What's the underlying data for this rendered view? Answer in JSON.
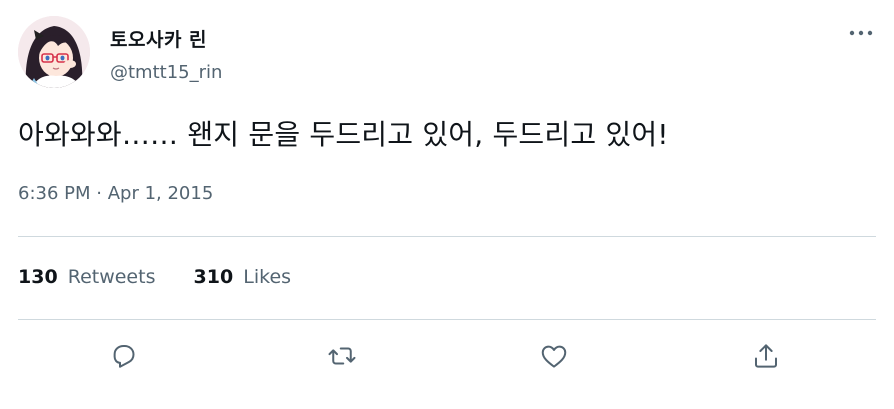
{
  "user": {
    "display_name": "토오사카 린",
    "handle": "@tmtt15_rin",
    "avatar_icon": "anime-girl-avatar"
  },
  "more_icon": "more-horizontal-icon",
  "tweet": {
    "text": "아와와와…… 왠지 문을 두드리고 있어, 두드리고 있어!"
  },
  "meta": {
    "time": "6:36 PM",
    "separator": "·",
    "date": "Apr 1, 2015"
  },
  "stats": {
    "retweets_count": "130",
    "retweets_label": "Retweets",
    "likes_count": "310",
    "likes_label": "Likes"
  },
  "actions": [
    {
      "icon": "reply-icon"
    },
    {
      "icon": "retweet-icon"
    },
    {
      "icon": "like-icon"
    },
    {
      "icon": "share-icon"
    }
  ],
  "colors": {
    "text_primary": "#0f1419",
    "text_secondary": "#536471",
    "divider": "#cfd9de"
  }
}
